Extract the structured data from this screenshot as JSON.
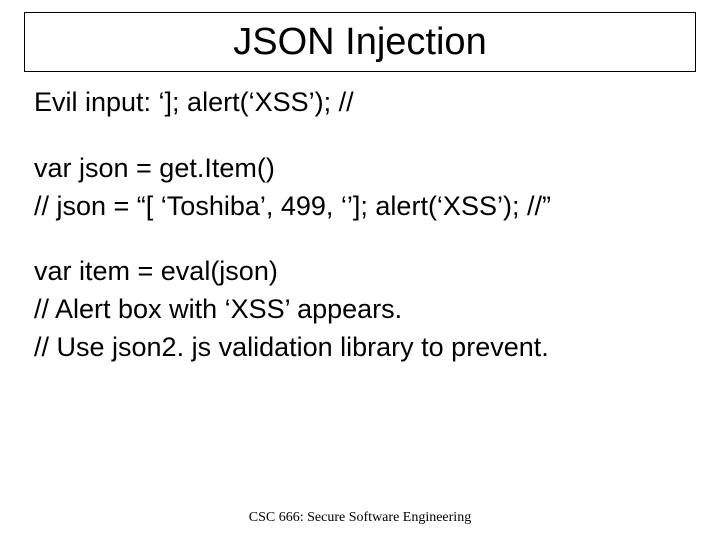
{
  "title": "JSON Injection",
  "body": {
    "l1": "Evil input: ‘]; alert(‘XSS’); //",
    "l2": "var json = get.Item()",
    "l3": "// json = “[ ‘Toshiba’, 499, ‘’]; alert(‘XSS’); //”",
    "l4": "var item = eval(json)",
    "l5": "// Alert box with ‘XSS’ appears.",
    "l6": "// Use json2. js validation library to prevent."
  },
  "footer": "CSC 666: Secure Software Engineering"
}
